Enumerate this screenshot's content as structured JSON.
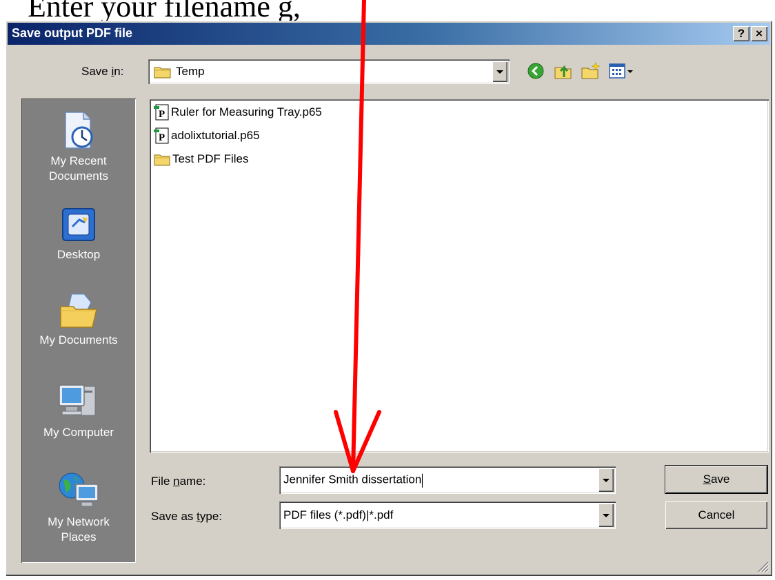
{
  "header_text": "Enter your filename g,",
  "dialog": {
    "title": "Save output PDF file",
    "help_button": "?",
    "close_button": "×"
  },
  "save_in": {
    "label_pre": "Save ",
    "label_u": "i",
    "label_post": "n:",
    "value": "Temp"
  },
  "places": [
    {
      "line1": "My Recent",
      "line2": "Documents",
      "icon": "recent-documents-icon"
    },
    {
      "line1": "Desktop",
      "line2": "",
      "icon": "desktop-icon"
    },
    {
      "line1": "My Documents",
      "line2": "",
      "icon": "my-documents-icon"
    },
    {
      "line1": "My Computer",
      "line2": "",
      "icon": "my-computer-icon"
    },
    {
      "line1": "My Network",
      "line2": "Places",
      "icon": "network-places-icon"
    }
  ],
  "files": [
    {
      "name": "Ruler for Measuring Tray.p65",
      "type": "pagemaker-file-icon"
    },
    {
      "name": "adolixtutorial.p65",
      "type": "pagemaker-file-icon"
    },
    {
      "name": "Test PDF Files",
      "type": "folder-icon"
    }
  ],
  "file_name": {
    "label_pre": "File ",
    "label_u": "n",
    "label_post": "ame:",
    "value": "Jennifer Smith dissertation"
  },
  "save_as_type": {
    "label_pre": "Save as ",
    "label_u": "t",
    "label_post": "ype:",
    "value": "PDF files (*.pdf)|*.pdf"
  },
  "buttons": {
    "save_u": "S",
    "save_rest": "ave",
    "cancel": "Cancel"
  },
  "annotation_color": "#ff0000"
}
